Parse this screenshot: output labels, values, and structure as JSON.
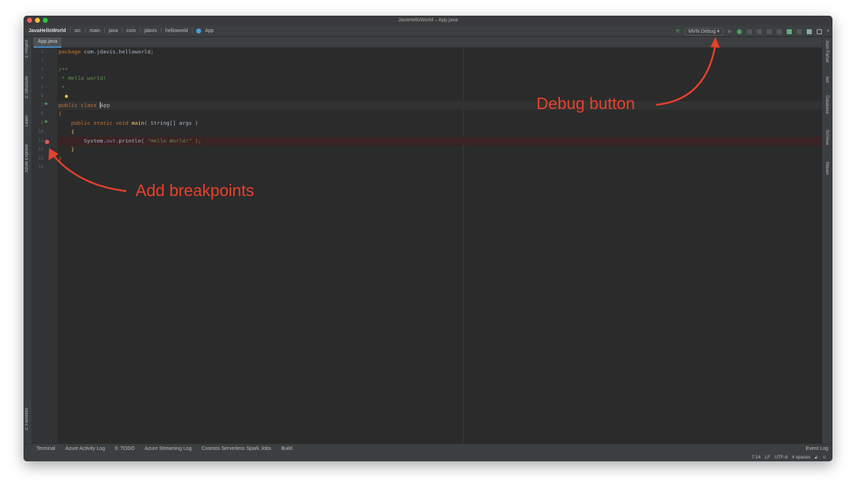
{
  "window": {
    "title": "JavaHelloWorld – App.java"
  },
  "breadcrumb": [
    "JavaHelloWorld",
    "src",
    "main",
    "java",
    "com",
    "jdavis",
    "helloworld",
    "App"
  ],
  "toolbar": {
    "run_config": "MVN Debug"
  },
  "tabs": [
    {
      "label": "App.java"
    }
  ],
  "left_tools": [
    "1: Project",
    "2: Structure",
    "Learn",
    "Azure Explorer",
    "2: Favorites"
  ],
  "right_tools": [
    "Json Parser",
    "Ant",
    "Database",
    "SciView",
    "Maven"
  ],
  "code": {
    "lines": [
      "1",
      "2",
      "3",
      "4",
      "5",
      "6",
      "7",
      "8",
      "9",
      "10",
      "11",
      "12",
      "13",
      "14"
    ],
    "l1a": "package",
    "l1b": " com.jdavis.helloworld;",
    "l3": "/**",
    "l4": " * Hello world!",
    "l5": " *",
    "l6": " */",
    "l7a": "public class ",
    "l7b": "App",
    "l8": "{",
    "l9a": "    public static void ",
    "l9b": "main",
    "l9c": "( String[] args )",
    "l10": "    {",
    "l11a": "        System.",
    "l11b": "out",
    "l11c": ".println( ",
    "l11d": "\"Hello World!\"",
    "l11e": " );",
    "l12": "    }",
    "l13": "}"
  },
  "bottom_tools": [
    "Terminal",
    "Azure Activity Log",
    "6: TODO",
    "Azure Streaming Log",
    "Cosmos Serverless Spark Jobs",
    "Build"
  ],
  "status": {
    "event_log": "Event Log",
    "position": "7:14",
    "line_sep": "LF",
    "encoding": "UTF-8",
    "indent": "4 spaces"
  },
  "annotations": {
    "debug": "Debug button",
    "breakpoints": "Add breakpoints"
  },
  "colors": {
    "annotation": "#e8412c",
    "breakpoint": "#db5c5c",
    "run": "#499c54"
  }
}
